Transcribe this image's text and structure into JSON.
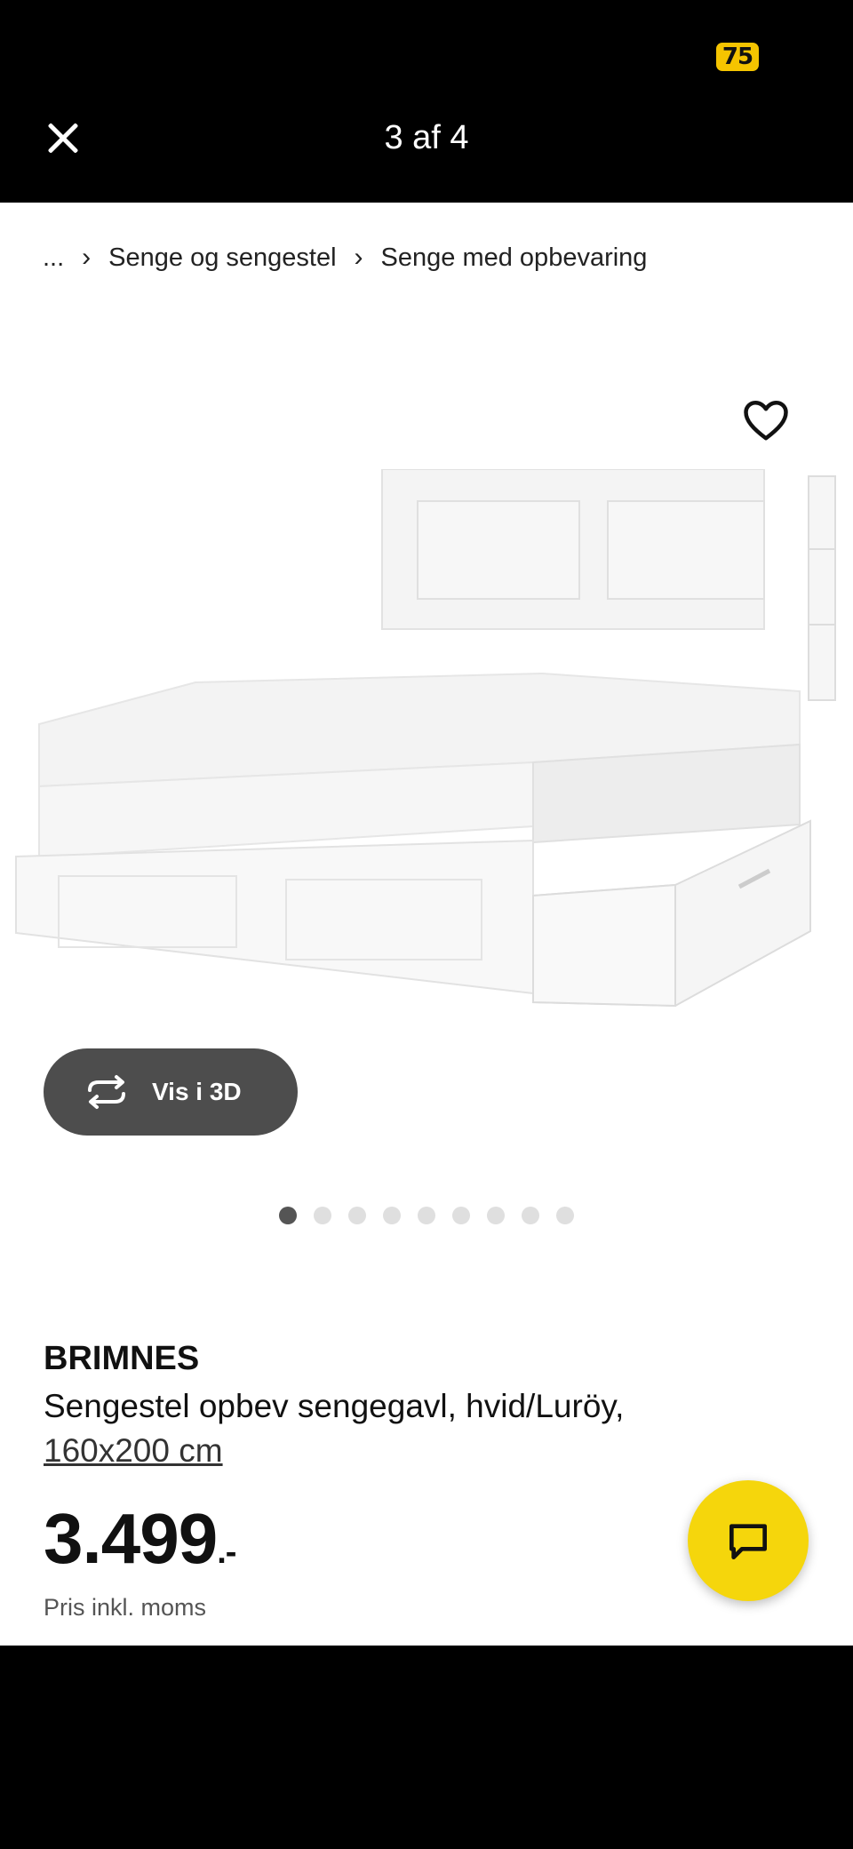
{
  "status_bar": {
    "battery_level": "75"
  },
  "viewer": {
    "counter": "3 af 4"
  },
  "breadcrumb": {
    "ellipsis": "...",
    "separator": "›",
    "items": [
      "Senge og sengestel",
      "Senge med opbevaring"
    ]
  },
  "gallery": {
    "view_3d_label": "Vis i 3D",
    "dot_count": 9,
    "active_index": 0
  },
  "product": {
    "brand": "BRIMNES",
    "description": "Sengestel opbev sengegavl, hvid/Luröy,",
    "size": "160x200 cm",
    "price": "3.499",
    "price_suffix": ".-",
    "price_note": "Pris inkl. moms"
  },
  "colors": {
    "accent_yellow": "#f5d60c",
    "battery_yellow": "#f5c400",
    "view3d_bg": "#4d4d4d"
  }
}
